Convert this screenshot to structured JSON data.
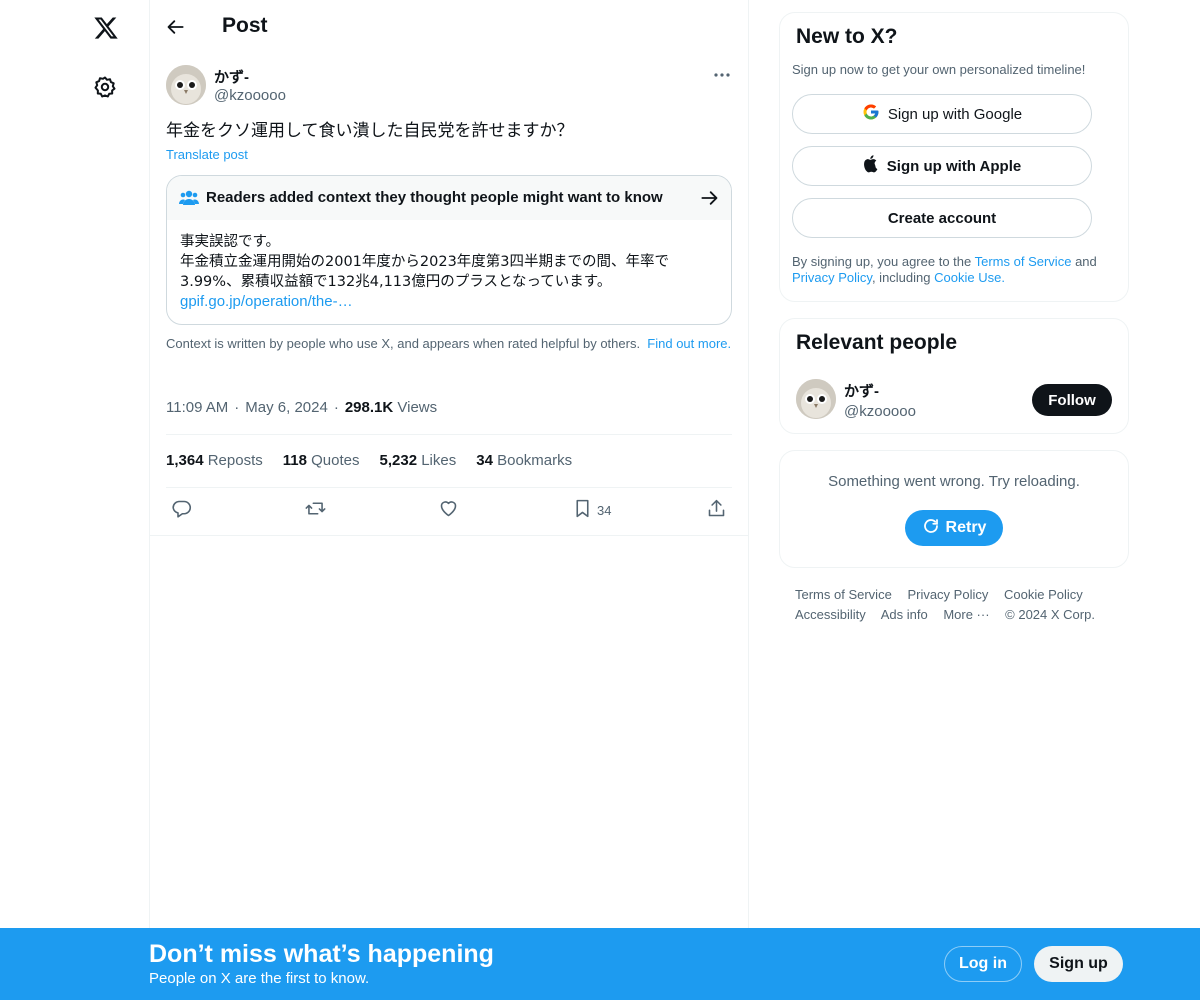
{
  "nav": {
    "logo_icon": "x-logo-icon",
    "settings_icon": "gear-icon"
  },
  "header": {
    "title": "Post"
  },
  "post": {
    "author_name": "かず-",
    "author_handle": "@kzooooo",
    "text": "年金をクソ運用して食い潰した自民党を許せますか？",
    "translate_label": "Translate post",
    "community_note": {
      "title": "Readers added context they thought people might want to know",
      "line1": "事実誤認です。",
      "line2": "年金積立金運用開始の2001年度から2023年度第3四半期までの間、年率で",
      "line3": "3.99%、累積収益額で132兆4,113億円のプラスとなっています。",
      "link": "gpif.go.jp/operation/the-…"
    },
    "context_text": "Context is written by people who use X, and appears when rated helpful by others.",
    "context_link": "Find out more.",
    "time": "11:09 AM",
    "date": "May 6, 2024",
    "views_count": "298.1K",
    "views_label": "Views",
    "stats": {
      "reposts_count": "1,364",
      "reposts_label": "Reposts",
      "quotes_count": "118",
      "quotes_label": "Quotes",
      "likes_count": "5,232",
      "likes_label": "Likes",
      "bookmarks_count": "34",
      "bookmarks_label": "Bookmarks"
    },
    "actions": {
      "bookmark_count": "34"
    }
  },
  "signup_card": {
    "title": "New to X?",
    "subtitle": "Sign up now to get your own personalized timeline!",
    "google_label": "Sign up with Google",
    "apple_label": "Sign up with Apple",
    "create_label": "Create account",
    "legal_prefix": "By signing up, you agree to the",
    "terms": "Terms of Service",
    "and": "and",
    "privacy": "Privacy Policy",
    "including": ", including",
    "cookie": "Cookie Use."
  },
  "relevant": {
    "title": "Relevant people",
    "name": "かず-",
    "handle": "@kzooooo",
    "follow_label": "Follow"
  },
  "error_card": {
    "message": "Something went wrong. Try reloading.",
    "retry_label": "Retry"
  },
  "footer": {
    "terms": "Terms of Service",
    "privacy": "Privacy Policy",
    "cookie": "Cookie Policy",
    "accessibility": "Accessibility",
    "ads": "Ads info",
    "more": "More ···",
    "copyright": "© 2024 X Corp."
  },
  "bottom_bar": {
    "title": "Don’t miss what’s happening",
    "subtitle": "People on X are the first to know.",
    "login_label": "Log in",
    "signup_label": "Sign up"
  },
  "colors": {
    "accent": "#1d9bf0",
    "text": "#0f1419",
    "muted": "#536471"
  }
}
